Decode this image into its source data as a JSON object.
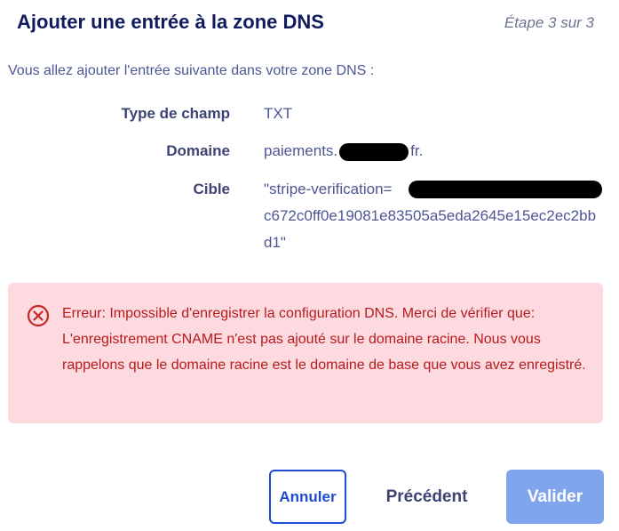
{
  "header": {
    "title": "Ajouter une entrée à la zone DNS",
    "step": "Étape 3 sur 3"
  },
  "intro": "Vous allez ajouter l'entrée suivante dans votre zone DNS :",
  "fields": {
    "type": {
      "label": "Type de champ",
      "value": "TXT"
    },
    "domain": {
      "label": "Domaine",
      "value_prefix": "paiements.",
      "value_suffix": "fr."
    },
    "target": {
      "label": "Cible",
      "value_prefix": "\"stripe-verification=",
      "value_rest": "c672c0ff0e19081e83505a5eda2645e15ec2ec2bbd1\""
    }
  },
  "error": {
    "icon": "error-circle-x-icon",
    "message": "Erreur: Impossible d'enregistrer la configuration DNS. Merci de vérifier que: L'enregistrement CNAME n'est pas ajouté sur le domaine racine. Nous vous rappelons que le domaine racine est le domaine de base que vous avez enregistré."
  },
  "buttons": {
    "cancel": "Annuler",
    "previous": "Précédent",
    "validate": "Valider"
  },
  "colors": {
    "title": "#0f1b5c",
    "error_bg": "#fdd9e0",
    "error_text": "#b71c1c",
    "primary": "#1e4bd1",
    "validate_disabled": "#7fa6ec"
  }
}
